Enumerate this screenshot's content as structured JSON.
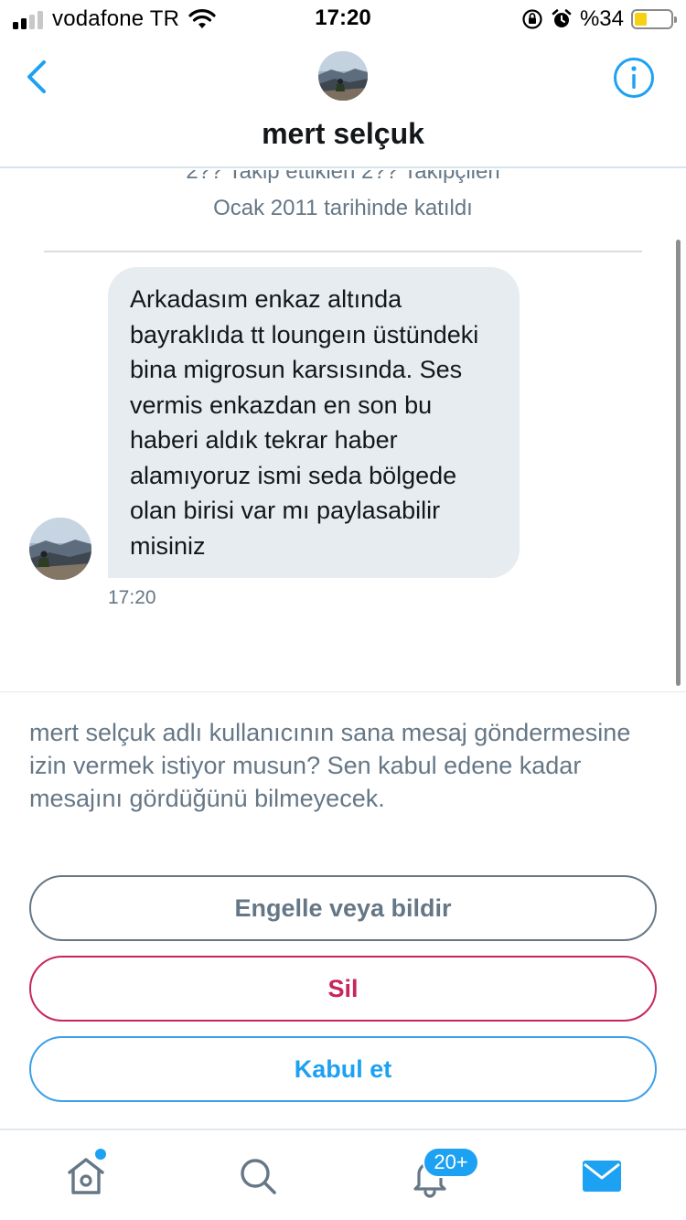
{
  "status_bar": {
    "carrier": "vodafone TR",
    "time": "17:20",
    "battery_percent": "%34",
    "battery_level": 0.34,
    "signal_bars": 4,
    "signal_active_bars": 2
  },
  "header": {
    "name": "mert selçuk",
    "back_icon": "chevron-left-icon",
    "info_icon": "info-icon"
  },
  "profile": {
    "stats_cut": "2?? Takip ettiklen 2?? Takipçileri",
    "joined": "Ocak 2011 tarihinde katıldı"
  },
  "message": {
    "text": "Arkadasım enkaz altında bayraklıda tt loungeın üstündeki bina migrosun karsısında. Ses vermis enkazdan en son bu haberi aldık tekrar haber alamıyoruz ismi seda bölgede olan birisi var mı paylasabilir misiniz",
    "time": "17:20"
  },
  "request": {
    "text": "mert selçuk adlı kullanıcının sana mesaj göndermesine izin vermek istiyor musun? Sen kabul edene kadar mesajını gördüğünü bilmeyecek.",
    "block_label": "Engelle veya bildir",
    "delete_label": "Sil",
    "accept_label": "Kabul et"
  },
  "tabbar": {
    "notifications_badge": "20+",
    "active_tab": "messages"
  },
  "colors": {
    "accent": "#1da1f2",
    "danger": "#c8265a",
    "muted": "#657786",
    "bubble": "#e6ecf0"
  }
}
